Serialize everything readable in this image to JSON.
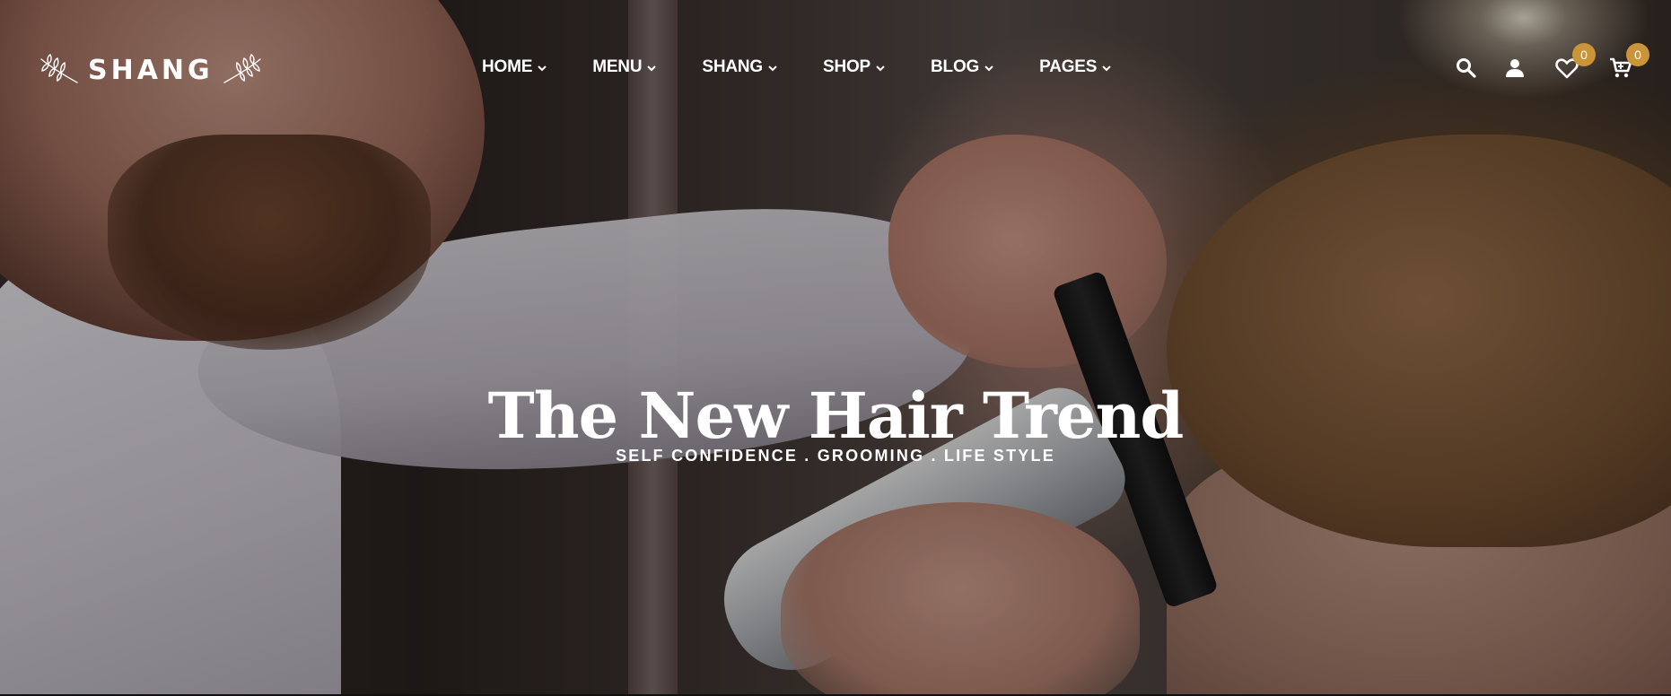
{
  "brand": {
    "name": "SHANG",
    "leaf_icon": "laurel-leaf-icon"
  },
  "nav": {
    "items": [
      {
        "label": "HOME"
      },
      {
        "label": "MENU"
      },
      {
        "label": "SHANG"
      },
      {
        "label": "SHOP"
      },
      {
        "label": "BLOG"
      },
      {
        "label": "PAGES"
      }
    ],
    "chevron_icon": "chevron-down-icon"
  },
  "actions": {
    "search_icon": "search-icon",
    "account_icon": "user-icon",
    "wishlist_icon": "heart-icon",
    "wishlist_count": "0",
    "cart_icon": "cart-icon",
    "cart_count": "0",
    "badge_color": "#c99538"
  },
  "hero": {
    "title": "The New Hair Trend",
    "subtitle": "SELF CONFIDENCE . GROOMING . LIFE STYLE"
  }
}
